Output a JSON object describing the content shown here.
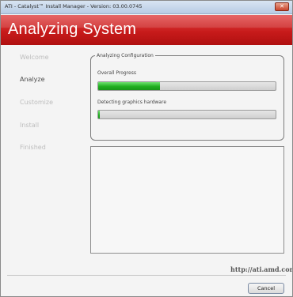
{
  "window": {
    "title": "ATI - Catalyst™ Install Manager - Version: 03.00.0745",
    "close_label": "✕"
  },
  "banner": {
    "title": "Analyzing System"
  },
  "steps": [
    {
      "label": "Welcome",
      "state": "inactive"
    },
    {
      "label": "Analyze",
      "state": "active"
    },
    {
      "label": "Customize",
      "state": "inactive"
    },
    {
      "label": "Install",
      "state": "inactive"
    },
    {
      "label": "Finished",
      "state": "inactive"
    }
  ],
  "analysis": {
    "group_label": "Analyzing Configuration",
    "overall_label": "Overall Progress",
    "overall_progress": 0.35,
    "task_label": "Detecting graphics hardware",
    "task_progress": 0.01
  },
  "footer": {
    "url": "http://ati.amd.com",
    "cancel_label": "Cancel"
  },
  "colors": {
    "banner_red": "#c81b1b",
    "progress_green": "#1fae1f"
  }
}
